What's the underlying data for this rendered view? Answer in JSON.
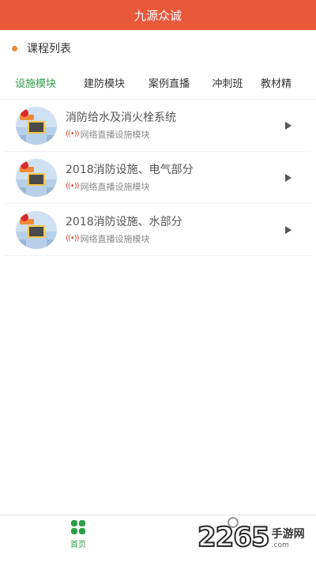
{
  "header": {
    "title": "九源众诚"
  },
  "section": {
    "title": "课程列表"
  },
  "tabs": [
    {
      "label": "设施模块",
      "active": true
    },
    {
      "label": "建防模块",
      "active": false
    },
    {
      "label": "案例直播",
      "active": false
    },
    {
      "label": "冲刺班",
      "active": false
    },
    {
      "label": "教材精",
      "active": false
    }
  ],
  "courses": [
    {
      "title": "消防给水及消火栓系统",
      "subtitle": "网络直播设施模块",
      "live_icon": "((•))"
    },
    {
      "title": "2018消防设施、电气部分",
      "subtitle": "网络直播设施模块",
      "live_icon": "((•))"
    },
    {
      "title": "2018消防设施、水部分",
      "subtitle": "网络直播设施模块",
      "live_icon": "((•))"
    }
  ],
  "bottom_nav": {
    "home_label": "首页"
  },
  "watermark": {
    "number": "2265",
    "cn": "手游网",
    "en": ".com"
  },
  "colors": {
    "header": "#e8583b",
    "accent": "#2e9e4a",
    "dot": "#f08a3a"
  }
}
